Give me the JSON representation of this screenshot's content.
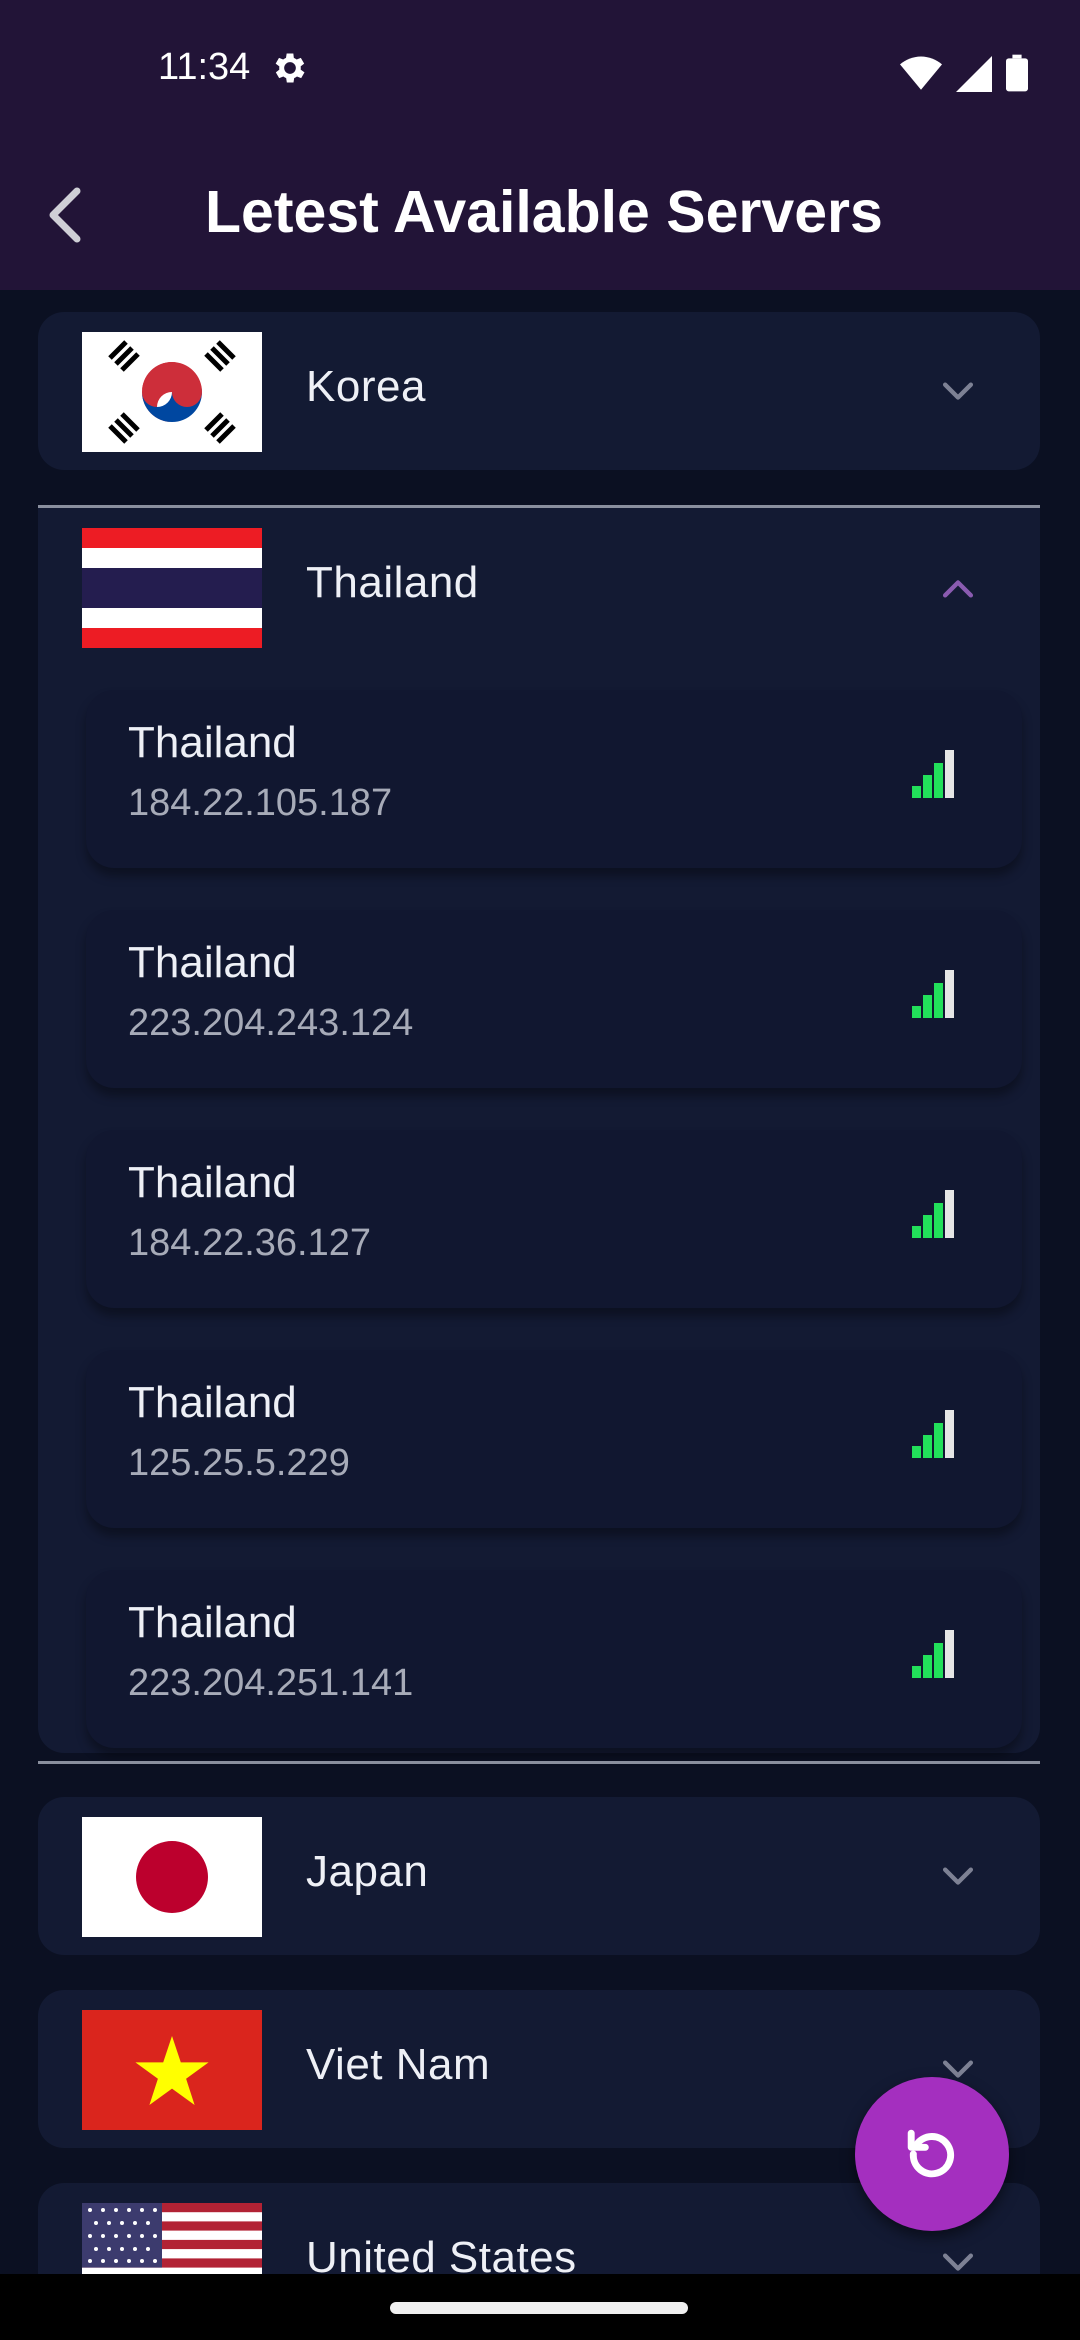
{
  "status_bar": {
    "time": "11:34",
    "icons": [
      "gear-icon",
      "wifi-icon",
      "cellular-signal-icon",
      "battery-icon"
    ]
  },
  "app_bar": {
    "back_icon": "arrow-back-icon",
    "title": "Letest Available Servers"
  },
  "countries": [
    {
      "name": "Korea",
      "flag": "korea-flag",
      "expanded": false
    },
    {
      "name": "Thailand",
      "flag": "thailand-flag",
      "expanded": true
    },
    {
      "name": "Japan",
      "flag": "japan-flag",
      "expanded": false
    },
    {
      "name": "Viet Nam",
      "flag": "vietnam-flag",
      "expanded": false
    },
    {
      "name": "United States",
      "flag": "usa-flag",
      "expanded": false
    }
  ],
  "servers": [
    {
      "name": "Thailand",
      "ip": "184.22.105.187",
      "signal_bars": 3,
      "signal_max": 4
    },
    {
      "name": "Thailand",
      "ip": "223.204.243.124",
      "signal_bars": 3,
      "signal_max": 4
    },
    {
      "name": "Thailand",
      "ip": "184.22.36.127",
      "signal_bars": 3,
      "signal_max": 4
    },
    {
      "name": "Thailand",
      "ip": "125.25.5.229",
      "signal_bars": 3,
      "signal_max": 4
    },
    {
      "name": "Thailand",
      "ip": "223.204.251.141",
      "signal_bars": 3,
      "signal_max": 4
    }
  ],
  "fab": {
    "icon": "refresh-icon"
  },
  "colors": {
    "header": "#221437",
    "background": "#0b1022",
    "card": "#131a33",
    "signal_active": "#22e05a",
    "signal_inactive": "#e6e6e6",
    "fab": "#a42fbf"
  }
}
